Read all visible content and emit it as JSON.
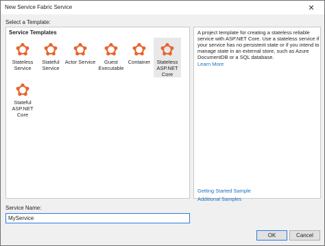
{
  "window": {
    "title": "New Service Fabric Service",
    "close_glyph": "✕"
  },
  "select_label": "Select a Template:",
  "templates": {
    "heading": "Service Templates",
    "items": [
      {
        "label": "Stateless\nService",
        "icon": "service-fabric-icon",
        "selected": false
      },
      {
        "label": "Stateful\nService",
        "icon": "service-fabric-icon",
        "selected": false
      },
      {
        "label": "Actor Service",
        "icon": "service-fabric-icon",
        "selected": false
      },
      {
        "label": "Guest\nExecutable",
        "icon": "service-fabric-icon",
        "selected": false
      },
      {
        "label": "Container",
        "icon": "service-fabric-icon",
        "selected": false
      },
      {
        "label": "Stateless\nASP.NET\nCore",
        "icon": "service-fabric-icon",
        "selected": true
      },
      {
        "label": "Stateful\nASP.NET\nCore",
        "icon": "service-fabric-icon",
        "selected": false
      }
    ]
  },
  "description": {
    "text": "A project template for creating a stateless reliable service with ASP.NET Core. Use a stateless service if your service has no persistent state or if you intend to manage state in an external store, such as Azure DocumentDB or a SQL database.",
    "learn_more": "Learn More",
    "getting_started": "Getting Started Sample",
    "additional_samples": "Additional Samples"
  },
  "service_name": {
    "label": "Service Name:",
    "value": "MyService"
  },
  "buttons": {
    "ok": "OK",
    "cancel": "Cancel"
  },
  "colors": {
    "icon": "#e8642c",
    "link": "#1e6fc1",
    "focus": "#2b79d8"
  }
}
